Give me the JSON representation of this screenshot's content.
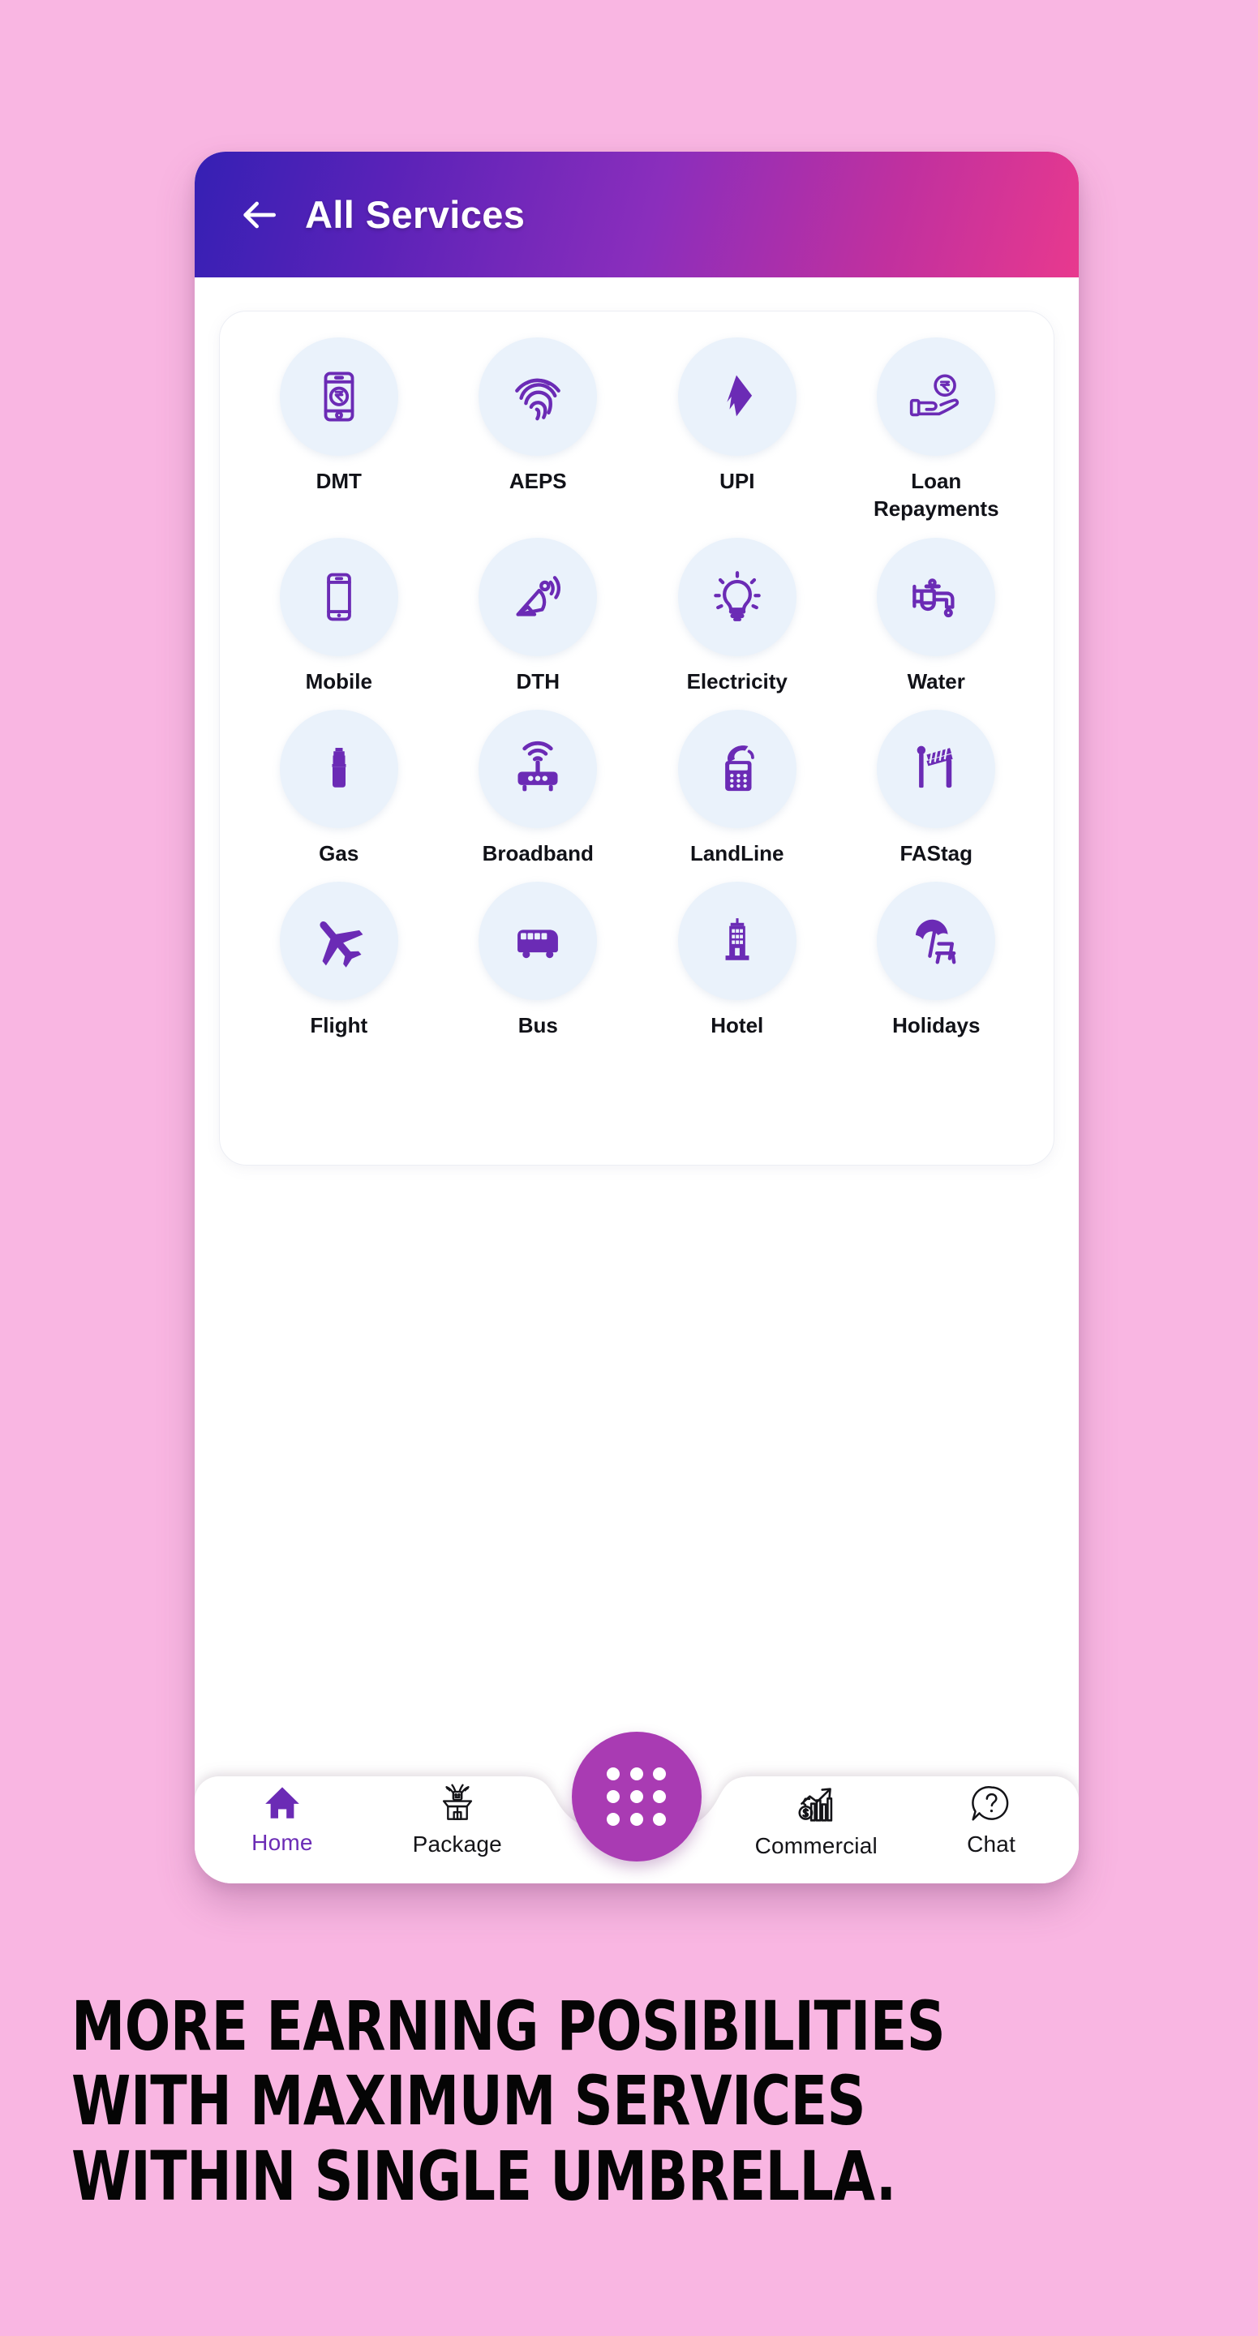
{
  "background_color": "#f9b6e2",
  "appbar": {
    "title": "All Services",
    "back_icon": "arrow-left-icon",
    "gradient_from": "#3520b4",
    "gradient_to": "#e8398e"
  },
  "services": {
    "accent_color": "#6b2bb5",
    "bubble_color": "#eaf2fb",
    "items": [
      {
        "label": "DMT",
        "icon": "mobile-rupee-icon"
      },
      {
        "label": "AEPS",
        "icon": "fingerprint-icon"
      },
      {
        "label": "UPI",
        "icon": "upi-bolt-icon"
      },
      {
        "label": "Loan Repayments",
        "icon": "hand-rupee-coin-icon"
      },
      {
        "label": "Mobile",
        "icon": "smartphone-icon"
      },
      {
        "label": "DTH",
        "icon": "satellite-dish-icon"
      },
      {
        "label": "Electricity",
        "icon": "light-bulb-icon"
      },
      {
        "label": "Water",
        "icon": "water-tap-icon"
      },
      {
        "label": "Gas",
        "icon": "gas-cylinder-icon"
      },
      {
        "label": "Broadband",
        "icon": "wifi-router-icon"
      },
      {
        "label": "LandLine",
        "icon": "landline-phone-icon"
      },
      {
        "label": "FAStag",
        "icon": "toll-barrier-icon"
      },
      {
        "label": "Flight",
        "icon": "airplane-icon"
      },
      {
        "label": "Bus",
        "icon": "bus-icon"
      },
      {
        "label": "Hotel",
        "icon": "building-icon"
      },
      {
        "label": "Holidays",
        "icon": "beach-umbrella-icon"
      }
    ]
  },
  "bottom_nav": {
    "active_color": "#6b2bb5",
    "fab": {
      "icon": "grid-dots-icon",
      "color": "#a93bb3"
    },
    "items": [
      {
        "label": "Home",
        "icon": "home-icon",
        "active": true
      },
      {
        "label": "Package",
        "icon": "gift-box-icon",
        "active": false
      },
      {
        "label": "Commercial",
        "icon": "growth-chart-money-icon",
        "active": false
      },
      {
        "label": "Chat",
        "icon": "question-chat-icon",
        "active": false
      }
    ]
  },
  "tagline": {
    "line1": "MORE EARNING POSIBILITIES",
    "line2": "WITH MAXIMUM SERVICES",
    "line3": "WITHIN SINGLE UMBRELLA."
  }
}
